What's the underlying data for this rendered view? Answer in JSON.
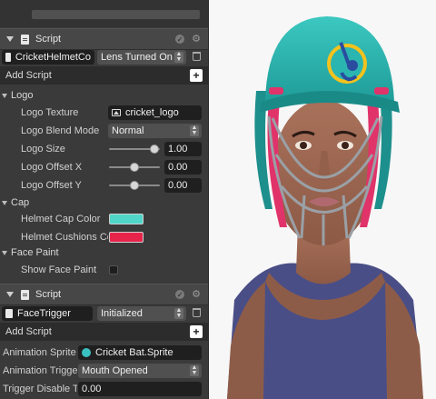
{
  "scripts": [
    {
      "header_title": "Script",
      "script_name": "CricketHelmetCo",
      "dropdown_value": "Lens Turned On",
      "add_script_label": "Add Script",
      "groups": [
        {
          "label": "Logo",
          "props": [
            {
              "label": "Logo Texture",
              "value": "cricket_logo"
            },
            {
              "label": "Logo Blend Mode",
              "value": "Normal"
            },
            {
              "label": "Logo Size",
              "value": "1.00",
              "slider_fraction": 0.9
            },
            {
              "label": "Logo Offset X",
              "value": "0.00",
              "slider_fraction": 0.5
            },
            {
              "label": "Logo Offset Y",
              "value": "0.00",
              "slider_fraction": 0.5
            }
          ]
        },
        {
          "label": "Cap",
          "props": [
            {
              "label": "Helmet Cap Color",
              "color": "#4fd6c8"
            },
            {
              "label": "Helmet Cushions Co",
              "color": "#e8244a"
            }
          ]
        },
        {
          "label": "Face Paint",
          "props": [
            {
              "label": "Show Face Paint",
              "checked": false
            }
          ]
        }
      ]
    },
    {
      "header_title": "Script",
      "script_name": "FaceTrigger",
      "dropdown_value": "Initialized",
      "add_script_label": "Add Script",
      "props": [
        {
          "label": "Animation Sprite",
          "value": "Cricket Bat.Sprite"
        },
        {
          "label": "Animation Trigger",
          "value": "Mouth Opened"
        },
        {
          "label": "Trigger Disable Ti",
          "value": "0.00"
        }
      ]
    }
  ],
  "colors": {
    "panel_bg": "#3a3a3a",
    "header_bg": "#474747",
    "helmet_teal": "#2bb5b0",
    "helmet_pink": "#e0336a",
    "logo_yellow": "#f4c21d",
    "logo_blue": "#2a4da0"
  },
  "icons": [
    "collapse-triangle-icon",
    "script-document-icon",
    "circle-info-icon",
    "gear-icon",
    "trash-icon",
    "plus-icon",
    "texture-icon",
    "sprite-icon"
  ]
}
